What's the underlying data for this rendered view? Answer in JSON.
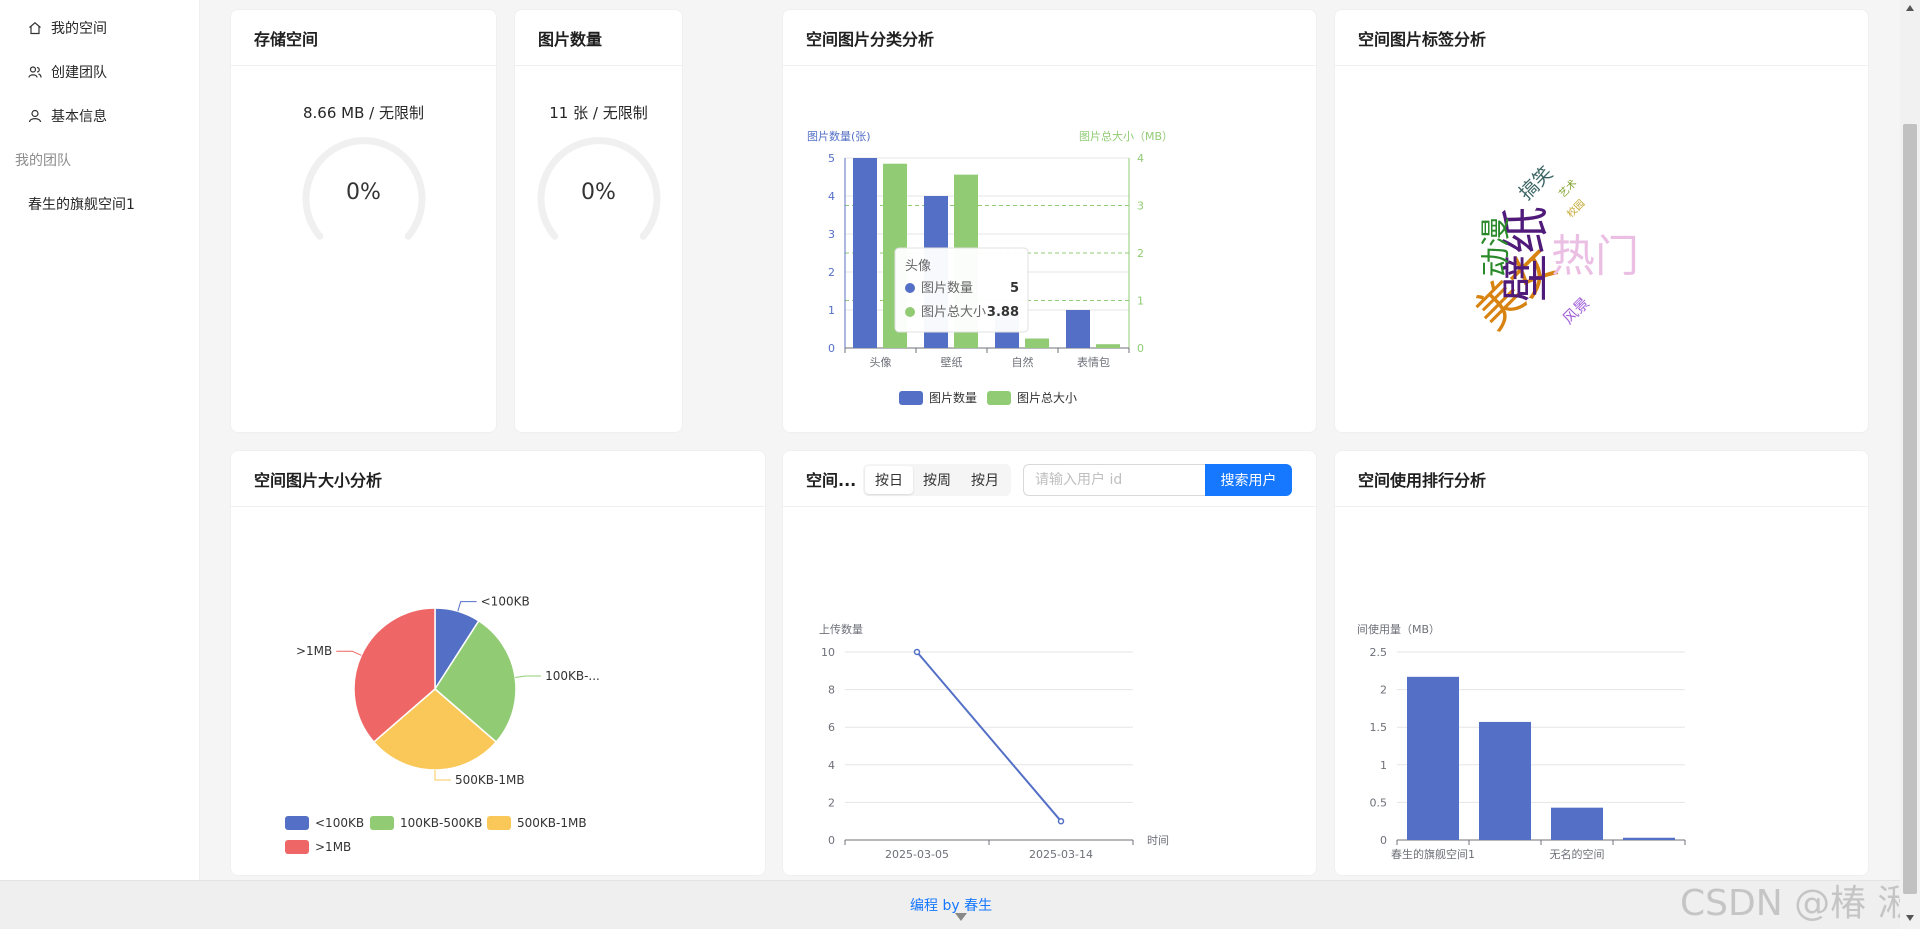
{
  "sidebar": {
    "items": [
      {
        "label": "我的空间",
        "icon": "home-icon"
      },
      {
        "label": "创建团队",
        "icon": "team-icon"
      },
      {
        "label": "基本信息",
        "icon": "user-icon"
      }
    ],
    "group_label": "我的团队",
    "teams": [
      "春生的旗舰空间1"
    ],
    "collapse_label": "<"
  },
  "storage": {
    "title": "存储空间",
    "used": "8.66 MB",
    "limit": "无限制",
    "usage_text": "8.66 MB / 无限制",
    "percent_label": "0%",
    "percent": 0
  },
  "count": {
    "title": "图片数量",
    "usage_text": "11 张 / 无限制",
    "percent_label": "0%",
    "percent": 0
  },
  "category": {
    "title": "空间图片分类分析",
    "tooltip": {
      "category": "头像",
      "rows": [
        {
          "name": "图片数量",
          "value": "5"
        },
        {
          "name": "图片总大小",
          "value": "3.88"
        }
      ]
    }
  },
  "tags": {
    "title": "空间图片标签分析",
    "words": [
      {
        "text": "美女"
      },
      {
        "text": "壁纸"
      },
      {
        "text": "热门"
      },
      {
        "text": "动漫"
      },
      {
        "text": "搞笑"
      },
      {
        "text": "风景"
      },
      {
        "text": "艺术"
      },
      {
        "text": "校园"
      }
    ]
  },
  "size": {
    "title": "空间图片大小分析"
  },
  "trend": {
    "title": "空间...",
    "segments": [
      "按日",
      "按周",
      "按月"
    ],
    "active_segment": "按日",
    "search_placeholder": "请输入用户 id",
    "search_button": "搜索用户"
  },
  "rank": {
    "title": "空间使用排行分析"
  },
  "footer": {
    "text": "编程 by 春生"
  },
  "watermark": "CSDN @椿  湫",
  "colors": {
    "blue": "#5470c6",
    "green": "#91cc75",
    "yellow": "#fac858",
    "red": "#ee6666",
    "primary": "#1677ff"
  },
  "chart_data": [
    {
      "type": "bar",
      "title": "空间图片分类分析",
      "categories": [
        "头像",
        "壁纸",
        "自然",
        "表情包"
      ],
      "series": [
        {
          "name": "图片数量",
          "axis": "left",
          "values": [
            5,
            4,
            1,
            1
          ]
        },
        {
          "name": "图片总大小",
          "axis": "right",
          "values": [
            3.88,
            3.65,
            0.2,
            0.08
          ]
        }
      ],
      "ylabel": "图片数量(张)",
      "ylabel_right": "图片总大小（MB）",
      "ylim": [
        0,
        5
      ],
      "ylim_right": [
        0,
        4
      ],
      "yticks": [
        0,
        1,
        2,
        3,
        4,
        5
      ],
      "yticks_right": [
        0,
        1,
        2,
        3,
        4
      ],
      "legend": "bottom"
    },
    {
      "type": "pie",
      "title": "空间图片大小分析",
      "labels": [
        "<100KB",
        "100KB-500KB",
        "500KB-1MB",
        ">1MB"
      ],
      "display_labels": [
        "<100KB",
        "100KB-...",
        "500KB-1MB",
        ">1MB"
      ],
      "values": [
        1,
        3,
        3,
        4
      ],
      "legend": "bottom-left"
    },
    {
      "type": "line",
      "x": [
        "2025-03-05",
        "2025-03-14"
      ],
      "y": [
        10,
        1
      ],
      "ylabel": "上传数量",
      "xlabel": "时间",
      "ylim": [
        0,
        10
      ],
      "yticks": [
        0,
        2,
        4,
        6,
        8,
        10
      ]
    },
    {
      "type": "bar",
      "title": "空间使用排行分析",
      "categories": [
        "春生的旗舰空间1",
        "",
        "无名的空间",
        ""
      ],
      "values": [
        2.17,
        1.57,
        0.43,
        0.03
      ],
      "ylabel": "间使用量（MB）",
      "ylim": [
        0,
        2.5
      ],
      "yticks": [
        0,
        0.5,
        1,
        1.5,
        2,
        2.5
      ]
    }
  ]
}
